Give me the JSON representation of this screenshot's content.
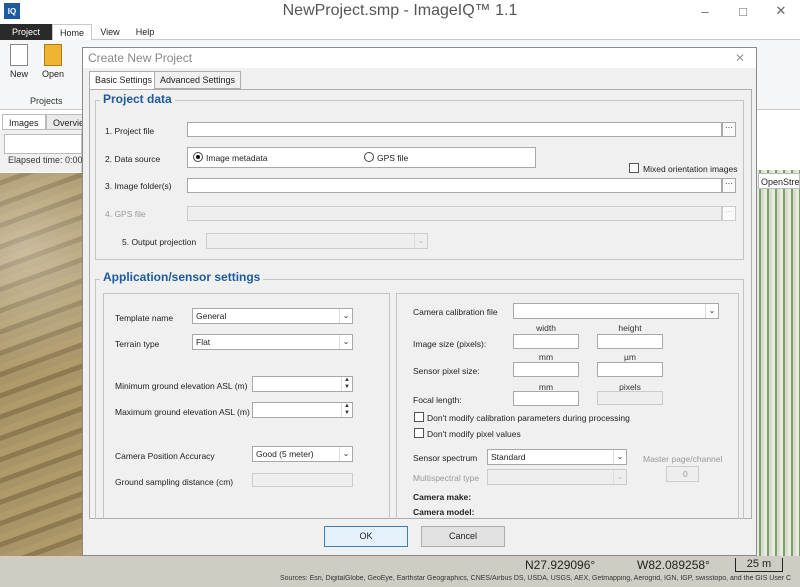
{
  "app": {
    "title": "NewProject.smp - ImageIQ™ 1.1",
    "logo": "IQ",
    "window_buttons": [
      "–",
      "□",
      "✕"
    ]
  },
  "ribbon": {
    "tabs": [
      "Project",
      "Home",
      "View",
      "Help"
    ],
    "buttons": [
      "New",
      "Open"
    ],
    "group_label": "Projects"
  },
  "panel": {
    "tabs": [
      "Images",
      "Overvie"
    ],
    "elapsed": "Elapsed time: 0:00:"
  },
  "map": {
    "layer_label": "OpenStree",
    "lat": "N27.929096°",
    "lon": "W82.089258°",
    "scale": "25 m",
    "sources": "Sources: Esri, DigitalGlobe, GeoEye, Earthstar Geographics, CNES/Airbus DS, USDA, USGS, AEX, Getmapping, Aerogrid, IGN, IGP, swisstopo, and the GIS User C"
  },
  "dialog": {
    "title": "Create New Project",
    "tabs": [
      "Basic Settings",
      "Advanced Settings"
    ],
    "project_data": {
      "heading": "Project data",
      "project_file_label": "1. Project file",
      "project_file_value": "",
      "data_source_label": "2. Data source",
      "source_option_metadata": "Image metadata",
      "source_option_gps": "GPS file",
      "selected_source": "Image metadata",
      "mixed_orientation_label": "Mixed orientation images",
      "image_folder_label": "3. Image folder(s)",
      "gps_file_label": "4. GPS file",
      "output_projection_label": "5. Output projection",
      "browse": "···"
    },
    "app_settings": {
      "heading": "Application/sensor settings",
      "template_name_label": "Template name",
      "template_name_value": "General",
      "terrain_type_label": "Terrain type",
      "terrain_type_value": "Flat",
      "min_elev_label": "Minimum ground elevation ASL (m)",
      "max_elev_label": "Maximum ground elevation ASL (m)",
      "cam_pos_acc_label": "Camera Position Accuracy",
      "cam_pos_acc_value": "Good (5 meter)",
      "gsd_label": "Ground sampling distance (cm)",
      "calib_file_label": "Camera calibration file",
      "col_width": "width",
      "col_height": "height",
      "image_size_label": "Image size (pixels):",
      "col_mm": "mm",
      "col_um": "µm",
      "sensor_pixel_label": "Sensor pixel size:",
      "col_mm2": "mm",
      "col_pixels": "pixels",
      "focal_length_label": "Focal length:",
      "no_calib_label": "Don't modify calibration parameters during processing",
      "no_pixel_label": "Don't modify pixel values",
      "spectrum_label": "Sensor spectrum",
      "spectrum_value": "Standard",
      "multispectral_label": "Multispectral type",
      "master_page_label": "Master page/channel",
      "master_page_value": "0",
      "camera_make_label": "Camera make:",
      "camera_model_label": "Camera model:"
    },
    "ok_label": "OK",
    "cancel_label": "Cancel"
  }
}
